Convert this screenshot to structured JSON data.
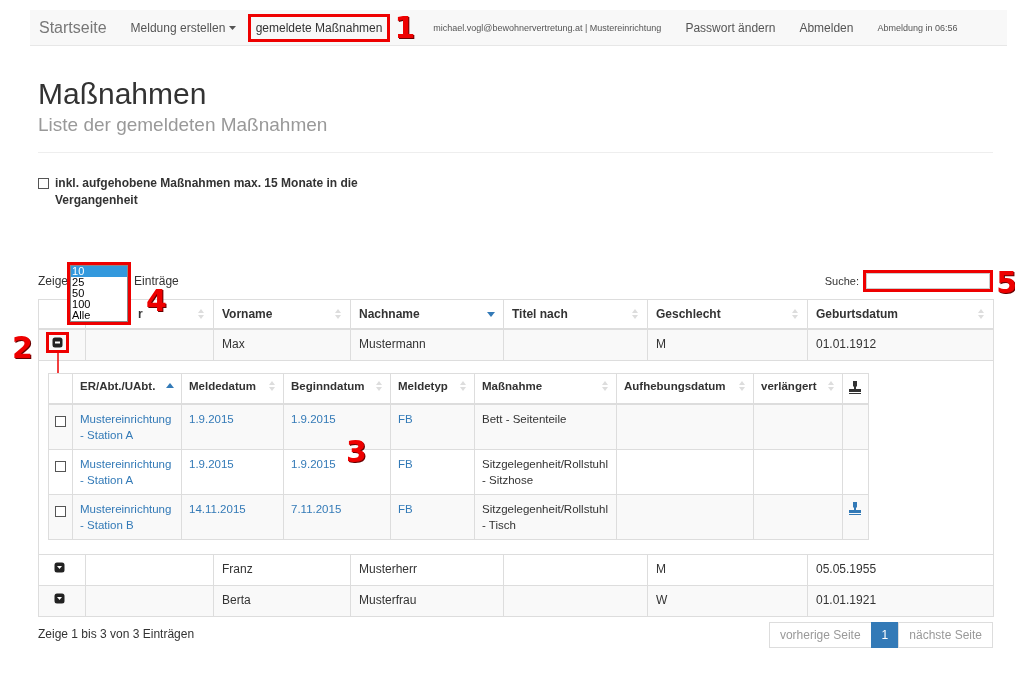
{
  "navbar": {
    "brand": "Startseite",
    "items": [
      {
        "kind": "dropdown",
        "label": "Meldung erstellen",
        "selected": false
      },
      {
        "kind": "link",
        "label": "gemeldete Maßnahmen",
        "selected": true,
        "callout": "1"
      },
      {
        "kind": "info",
        "label": "michael.vogl@bewohnervertretung.at | Mustereinrichtung"
      },
      {
        "kind": "link",
        "label": "Passwort ändern",
        "selected": false
      },
      {
        "kind": "link",
        "label": "Abmelden",
        "selected": false
      },
      {
        "kind": "info",
        "label": "Abmeldung in 06:56"
      }
    ]
  },
  "page": {
    "title": "Maßnahmen",
    "subtitle": "Liste der gemeldeten Maßnahmen"
  },
  "filter": {
    "label": "inkl. aufgehobene Maßnahmen max. 15 Monate in die Vergangenheit",
    "checked": false
  },
  "page_size": {
    "before": "Zeige",
    "after": "Einträge",
    "callout": "4",
    "options": [
      {
        "label": "10",
        "selected": true
      },
      {
        "label": "25",
        "selected": false
      },
      {
        "label": "50",
        "selected": false
      },
      {
        "label": "100",
        "selected": false
      },
      {
        "label": "Alle",
        "selected": false
      }
    ]
  },
  "search": {
    "label": "Suche:",
    "callout": "5"
  },
  "table": {
    "columns": [
      {
        "kind": "expander"
      },
      {
        "kind": "text",
        "label": "r",
        "sorted": false
      },
      {
        "kind": "text",
        "label": "Vorname",
        "sorted": false
      },
      {
        "kind": "text",
        "label": "Nachname",
        "sorted": true,
        "descending": true
      },
      {
        "kind": "text",
        "label": "Titel nach",
        "sorted": false
      },
      {
        "kind": "text",
        "label": "Geschlecht",
        "sorted": false
      },
      {
        "kind": "text",
        "label": "Geburtsdatum",
        "sorted": false
      }
    ],
    "rows": [
      {
        "expanded": true,
        "callout": "2",
        "cells": [
          "",
          "",
          "Max",
          "Mustermann",
          "",
          "M",
          "01.01.1912"
        ],
        "detail": {
          "callout": "3",
          "columns": [
            {
              "kind": "checkbox"
            },
            {
              "kind": "link",
              "label": "ER/Abt./UAbt.",
              "sorted": true,
              "descending": false
            },
            {
              "kind": "link",
              "label": "Meldedatum",
              "sorted": false
            },
            {
              "kind": "link",
              "label": "Beginndatum",
              "sorted": false
            },
            {
              "kind": "link",
              "label": "Meldetyp",
              "sorted": false
            },
            {
              "kind": "text",
              "label": "Maßnahme",
              "sorted": false
            },
            {
              "kind": "text",
              "label": "Aufhebungsdatum",
              "sorted": false
            },
            {
              "kind": "text",
              "label": "verlängert",
              "sorted": false
            },
            {
              "kind": "icon"
            }
          ],
          "rows": [
            {
              "checked": false,
              "stamp": false,
              "cells": [
                "",
                "Mustereinrichtung - Station A",
                "1.9.2015",
                "1.9.2015",
                "FB",
                "Bett - Seitenteile",
                "",
                "",
                ""
              ]
            },
            {
              "checked": false,
              "stamp": false,
              "cells": [
                "",
                "Mustereinrichtung - Station A",
                "1.9.2015",
                "1.9.2015",
                "FB",
                "Sitzgelegenheit/Rollstuhl - Sitzhose",
                "",
                "",
                ""
              ]
            },
            {
              "checked": false,
              "stamp": true,
              "cells": [
                "",
                "Mustereinrichtung - Station B",
                "14.11.2015",
                "7.11.2015",
                "FB",
                "Sitzgelegenheit/Rollstuhl - Tisch",
                "",
                "",
                ""
              ]
            }
          ]
        }
      },
      {
        "expanded": false,
        "cells": [
          "",
          "",
          "Franz",
          "Musterherr",
          "",
          "M",
          "05.05.1955"
        ]
      },
      {
        "expanded": false,
        "cells": [
          "",
          "",
          "Berta",
          "Musterfrau",
          "",
          "W",
          "01.01.1921"
        ]
      }
    ]
  },
  "footer": {
    "info": "Zeige 1 bis 3 von 3 Einträgen",
    "pages": [
      {
        "label": "vorherige Seite",
        "selected": false,
        "disabled": true
      },
      {
        "label": "1",
        "selected": true,
        "disabled": false
      },
      {
        "label": "nächste Seite",
        "selected": false,
        "disabled": true
      }
    ]
  }
}
